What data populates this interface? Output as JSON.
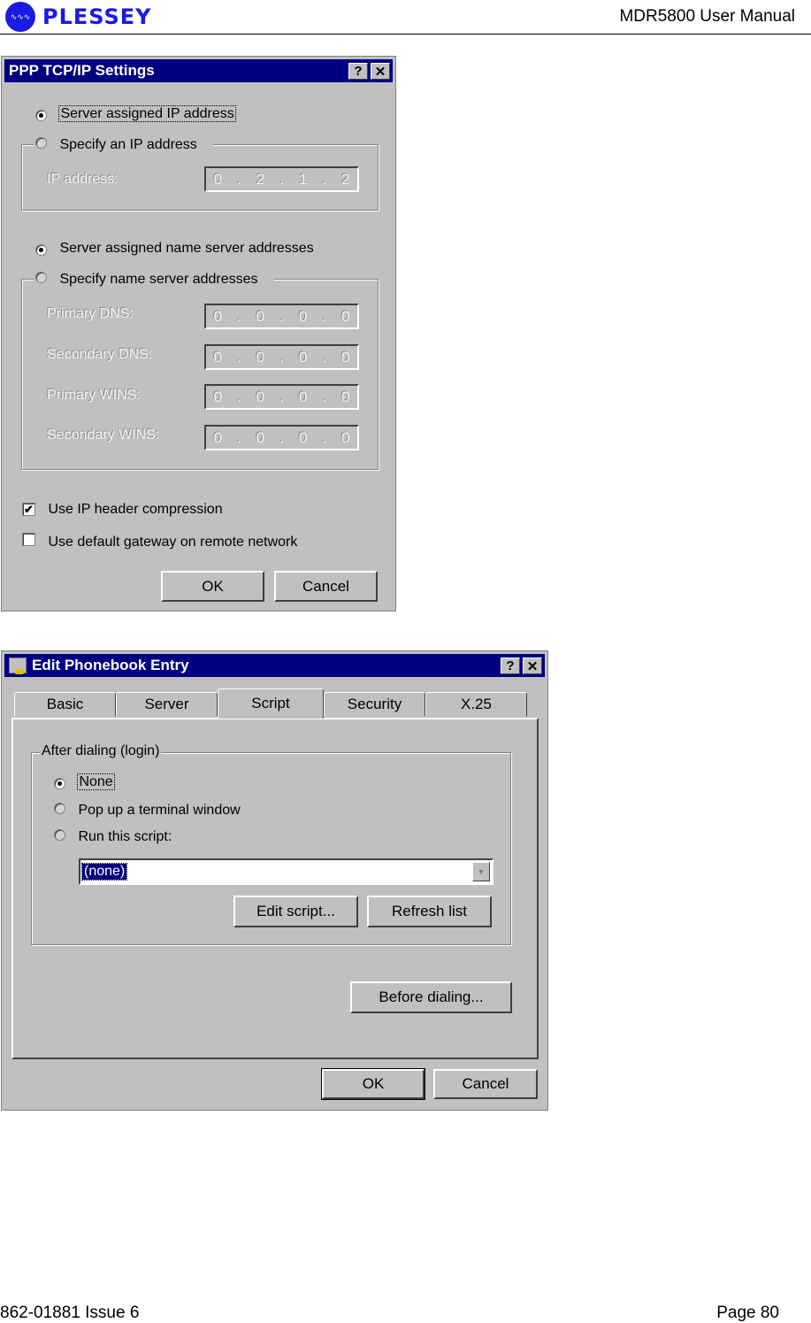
{
  "page_header": {
    "logo_text": "PLESSEY",
    "logo_icon": "waveform-icon",
    "document_title": "MDR5800 User Manual"
  },
  "page_footer": {
    "doc_number": "862-01881 Issue 6",
    "page_number": "Page 80"
  },
  "ppp_dialog": {
    "title": "PPP TCP/IP Settings",
    "help_button": "?",
    "close_button": "✕",
    "ip_options": [
      {
        "label": "Server assigned IP address",
        "selected": true
      },
      {
        "label": "Specify an IP address",
        "selected": false
      }
    ],
    "ip_address": {
      "label": "IP address:",
      "octets": [
        "0",
        "2",
        "1",
        "2"
      ]
    },
    "ns_options": [
      {
        "label": "Server assigned name server addresses",
        "selected": true
      },
      {
        "label": "Specify name server addresses",
        "selected": false
      }
    ],
    "ns_fields": [
      {
        "label": "Primary DNS:",
        "octets": [
          "0",
          "0",
          "0",
          "0"
        ]
      },
      {
        "label": "Secondary DNS:",
        "octets": [
          "0",
          "0",
          "0",
          "0"
        ]
      },
      {
        "label": "Primary WINS:",
        "octets": [
          "0",
          "0",
          "0",
          "0"
        ]
      },
      {
        "label": "Secondary WINS:",
        "octets": [
          "0",
          "0",
          "0",
          "0"
        ]
      }
    ],
    "checkboxes": [
      {
        "label": "Use IP header compression",
        "checked": true,
        "mark": "✔"
      },
      {
        "label": "Use default gateway on remote network",
        "checked": false,
        "mark": ""
      }
    ],
    "ok_label": "OK",
    "cancel_label": "Cancel"
  },
  "phonebook_dialog": {
    "title": "Edit Phonebook Entry",
    "help_button": "?",
    "close_button": "✕",
    "tabs": [
      {
        "label": "Basic",
        "active": false
      },
      {
        "label": "Server",
        "active": false
      },
      {
        "label": "Script",
        "active": true
      },
      {
        "label": "Security",
        "active": false
      },
      {
        "label": "X.25",
        "active": false
      }
    ],
    "group_label": "After dialing (login)",
    "script_options": [
      {
        "label": "None",
        "selected": true
      },
      {
        "label": "Pop up a terminal window",
        "selected": false
      },
      {
        "label": "Run this script:",
        "selected": false
      }
    ],
    "script_select_value": "(none)",
    "edit_script_label": "Edit script...",
    "refresh_list_label": "Refresh list",
    "before_dialing_label": "Before dialing...",
    "ok_label": "OK",
    "cancel_label": "Cancel"
  }
}
